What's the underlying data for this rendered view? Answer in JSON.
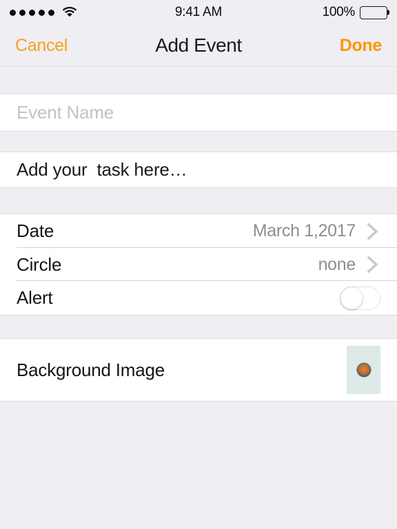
{
  "status_bar": {
    "signal_dots": 5,
    "wifi_icon": "wifi-icon",
    "time": "9:41 AM",
    "battery_percent": "100%",
    "battery_level": 100
  },
  "nav_bar": {
    "cancel_label": "Cancel",
    "title": "Add Event",
    "done_label": "Done",
    "accent_color": "#fb9700"
  },
  "form": {
    "event_name": {
      "label": "Event Name",
      "placeholder": "Event Name",
      "value": ""
    },
    "task": {
      "value": "Add your  task here…"
    },
    "rows": [
      {
        "label": "Date",
        "value": "March 1,2017",
        "accessory": "chevron-right-icon"
      },
      {
        "label": "Circle",
        "value": "none",
        "accessory": "chevron-right-icon"
      },
      {
        "label": "Alert",
        "value": "",
        "accessory": "toggle-switch",
        "toggle_on": false
      }
    ],
    "background_image": {
      "label": "Background Image",
      "thumbnail": "doorknob-thumbnail",
      "thumbnail_bg_color": "#dde9e6"
    }
  },
  "colors": {
    "screen_background": "#efeef3",
    "card_background": "#ffffff",
    "separator": "#d2d2d6",
    "secondary_text": "#8e8e93",
    "placeholder_text": "#c2c2c7",
    "chevron": "#c7c7cc"
  }
}
